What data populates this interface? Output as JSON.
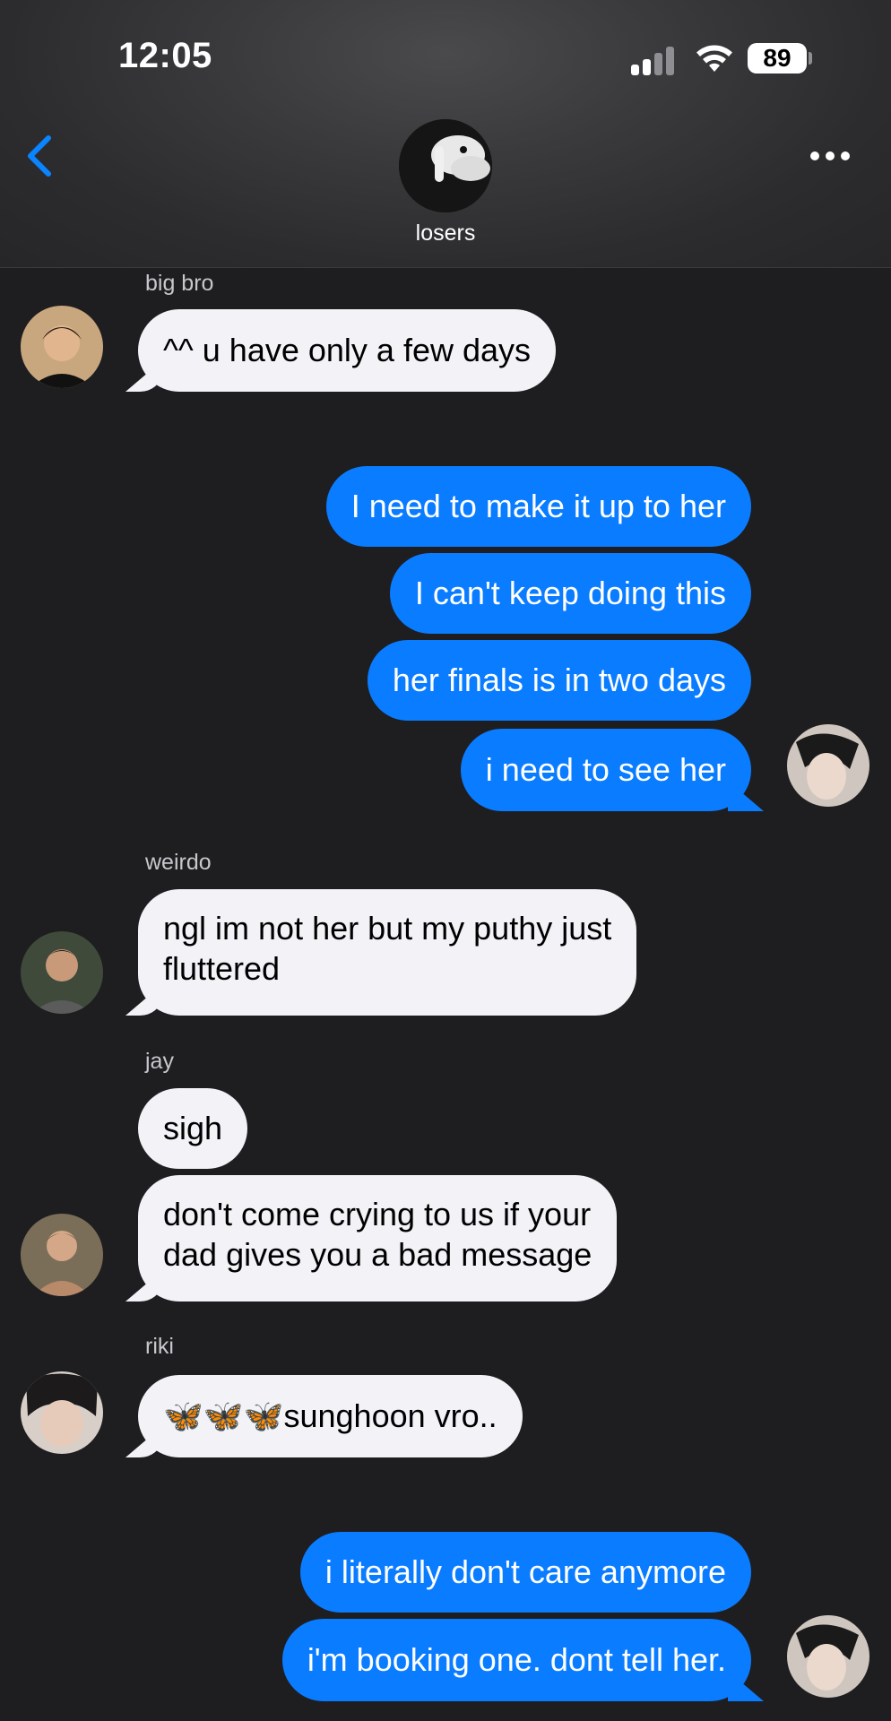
{
  "status_bar": {
    "time": "12:05",
    "battery": "89"
  },
  "conversation": {
    "name": "losers"
  },
  "messages": [
    {
      "sender": "big bro",
      "text": "^^ u have only a few days"
    },
    {
      "text": "I need to make it up to her"
    },
    {
      "text": "I can't keep doing this"
    },
    {
      "text": "her finals is in two days"
    },
    {
      "text": "i need to see her"
    },
    {
      "sender": "weirdo",
      "line1": "ngl im not her but my puthy just",
      "line2": "fluttered"
    },
    {
      "sender": "jay",
      "text": "sigh"
    },
    {
      "line1": "don't come crying to us if your",
      "line2": "dad gives you a bad message"
    },
    {
      "sender": "riki",
      "emoji": "🦋🦋🦋",
      "text": "sunghoon vro.."
    },
    {
      "text": "i literally don't care anymore"
    },
    {
      "text": "i'm booking one. dont tell her."
    }
  ],
  "colors": {
    "outgoing_bubble": "#0a7cff",
    "incoming_bubble": "#f2f2f7",
    "background": "#1e1e20",
    "accent": "#0a84ff"
  }
}
